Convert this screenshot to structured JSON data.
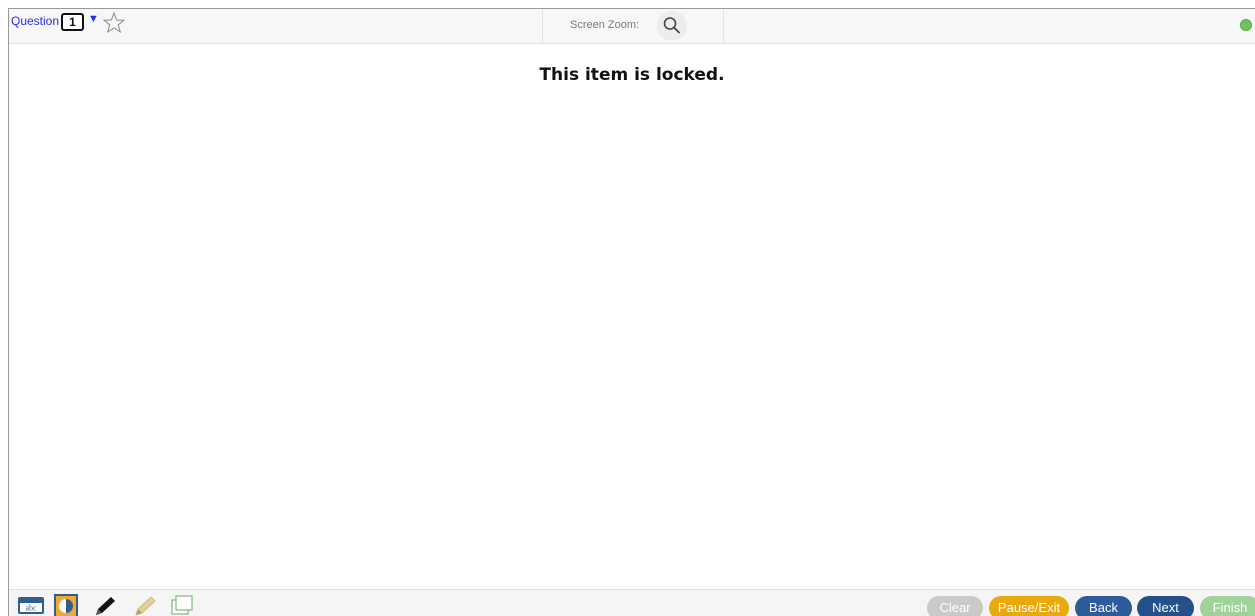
{
  "topbar": {
    "question_label": "Question",
    "question_number": "1",
    "dropdown_caret": "▼",
    "zoom_label": "Screen Zoom:",
    "icons": {
      "flag": "star-icon",
      "zoom": "magnifier-icon",
      "status": "status-dot"
    }
  },
  "main": {
    "message": "This item is locked."
  },
  "toolbar": {
    "tools": [
      {
        "name": "line-reader-icon",
        "label": "abc"
      },
      {
        "name": "contrast-icon"
      },
      {
        "name": "pen-icon"
      },
      {
        "name": "highlighter-icon"
      },
      {
        "name": "notepad-icon"
      }
    ],
    "buttons": {
      "clear": "Clear",
      "pause_exit": "Pause/Exit",
      "back": "Back",
      "next": "Next",
      "finish": "Finish"
    }
  },
  "colors": {
    "question_link": "#2a2af0",
    "status_dot": "#6fc35f",
    "clear_disabled": "#c9c9c9",
    "pause_exit": "#e9a90d",
    "back": "#2c5c9a",
    "next": "#24508c",
    "finish_disabled": "#9fd39a"
  }
}
